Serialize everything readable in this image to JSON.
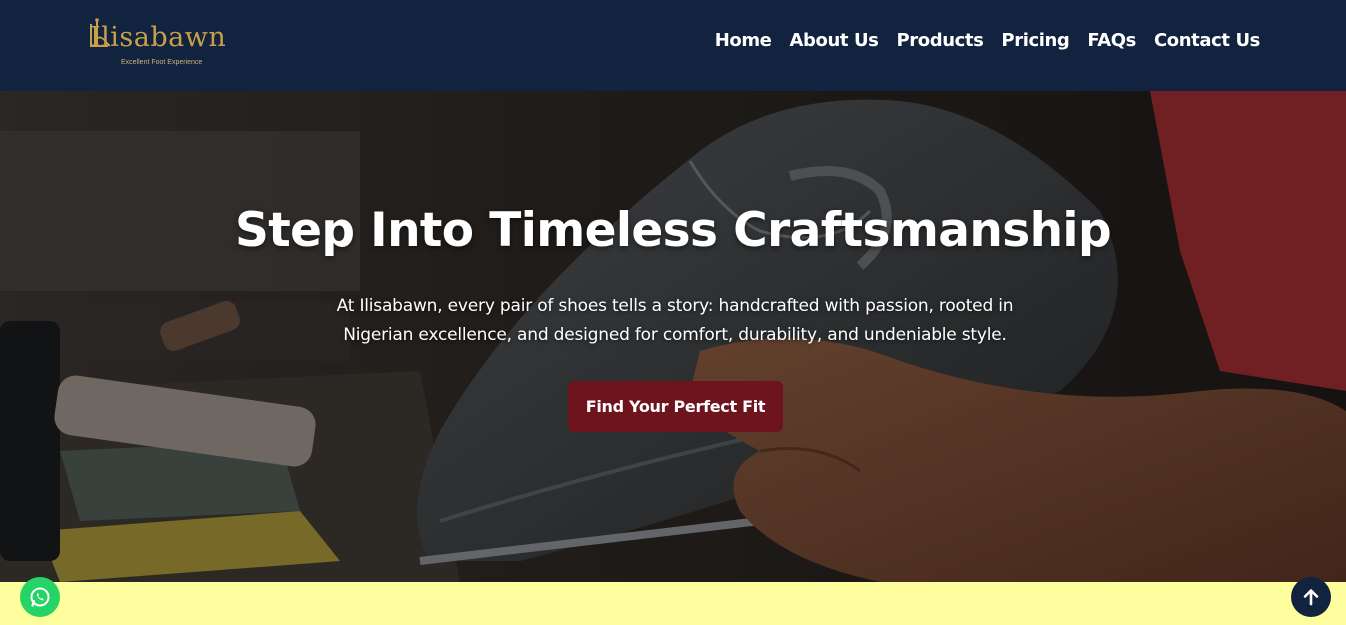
{
  "brand": {
    "name": "Ilisabawn",
    "tagline": "Excellent Foot Experience",
    "color": "#c9a04a"
  },
  "nav": {
    "items": [
      {
        "label": "Home"
      },
      {
        "label": "About Us"
      },
      {
        "label": "Products"
      },
      {
        "label": "Pricing"
      },
      {
        "label": "FAQs"
      },
      {
        "label": "Contact Us"
      }
    ]
  },
  "hero": {
    "title": "Step Into Timeless Craftsmanship",
    "subtitle": "At Ilisabawn, every pair of shoes tells a story: handcrafted with passion, rooted in Nigerian excellence, and designed for comfort, durability, and undeniable style.",
    "cta_label": "Find Your Perfect Fit",
    "cta_color": "#6e141c"
  },
  "floating": {
    "whatsapp_icon": "whatsapp-icon",
    "back_to_top_icon": "arrow-up-icon"
  },
  "colors": {
    "navbar": "#12233f",
    "section_below": "#fffe9f",
    "whatsapp": "#25d366"
  }
}
